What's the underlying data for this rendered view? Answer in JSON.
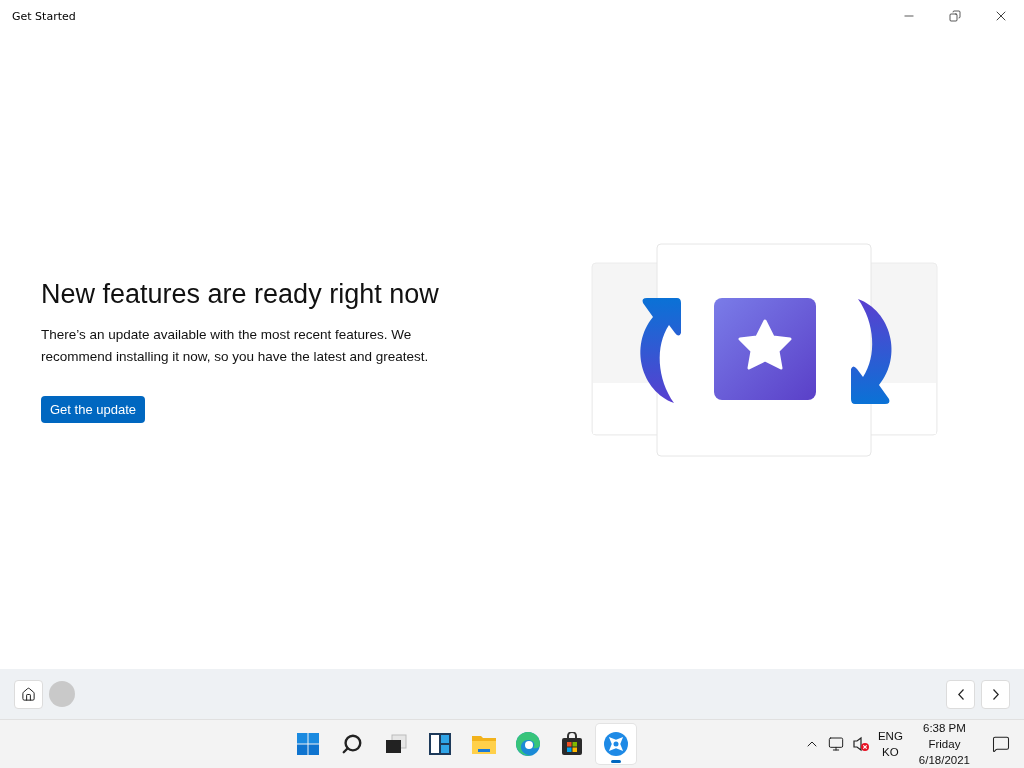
{
  "window": {
    "title": "Get Started"
  },
  "page": {
    "heading": "New features are ready right now",
    "body": "There’s an update available with the most recent features. We recommend installing it now, so you have the latest and greatest.",
    "button": "Get the update"
  },
  "taskbar": {
    "apps": [
      {
        "kind": "start",
        "selected": false
      },
      {
        "kind": "search",
        "selected": false
      },
      {
        "kind": "taskview",
        "selected": false
      },
      {
        "kind": "widgets",
        "selected": false
      },
      {
        "kind": "explorer",
        "selected": false
      },
      {
        "kind": "edge",
        "selected": false
      },
      {
        "kind": "store",
        "selected": false
      },
      {
        "kind": "tips",
        "selected": true
      }
    ],
    "language": [
      "ENG",
      "KO"
    ],
    "clock": [
      "6:38 PM",
      "Friday",
      "6/18/2021"
    ]
  }
}
